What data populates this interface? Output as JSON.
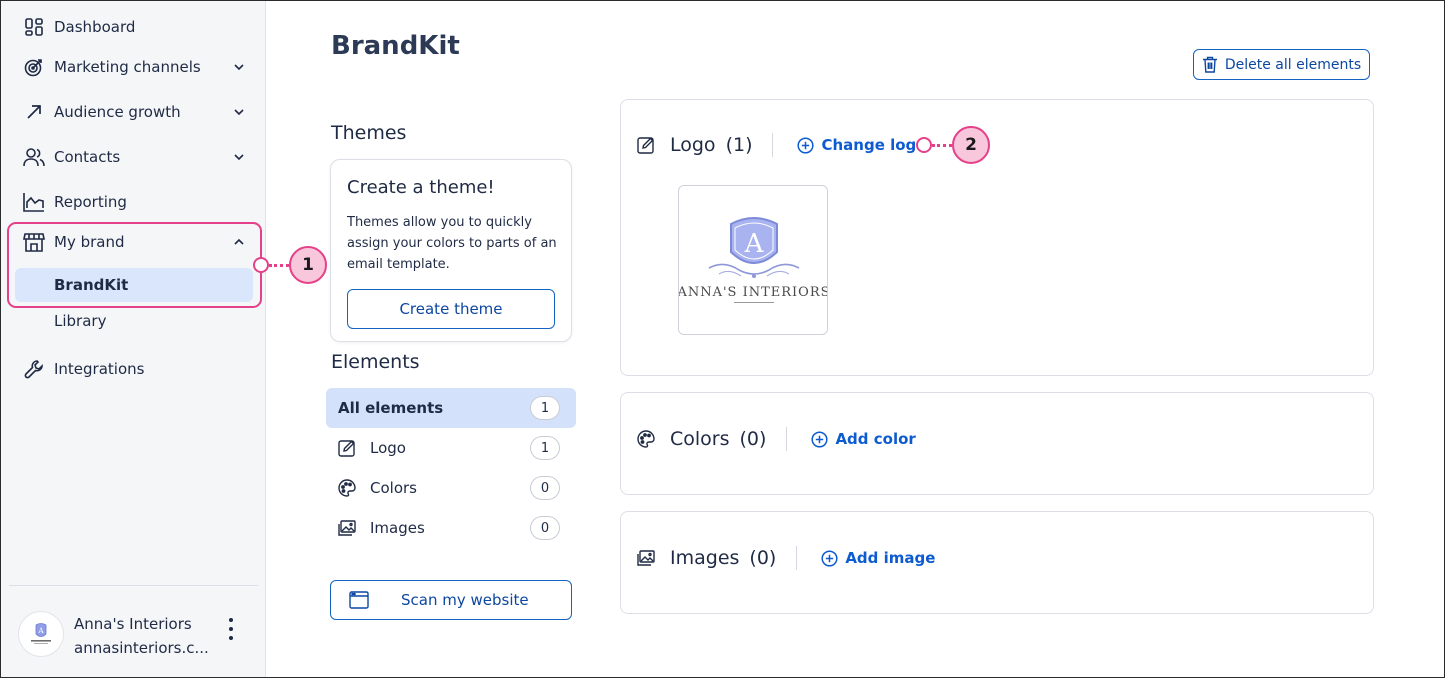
{
  "sidebar": {
    "items": [
      {
        "label": "Dashboard",
        "icon": "dashboard-icon"
      },
      {
        "label": "Marketing channels",
        "icon": "target-icon",
        "expandable": true
      },
      {
        "label": "Audience growth",
        "icon": "arrow-up-right-icon",
        "expandable": true
      },
      {
        "label": "Contacts",
        "icon": "contacts-icon",
        "expandable": true
      },
      {
        "label": "Reporting",
        "icon": "chart-icon"
      },
      {
        "label": "My brand",
        "icon": "storefront-icon",
        "expanded": true
      },
      {
        "label": "Integrations",
        "icon": "wrench-icon"
      }
    ],
    "sub_items": [
      {
        "label": "BrandKit",
        "active": true
      },
      {
        "label": "Library"
      }
    ],
    "account": {
      "name": "Anna's Interiors",
      "email": "annasinteriors.c..."
    }
  },
  "callouts": [
    "1",
    "2"
  ],
  "page": {
    "title": "BrandKit",
    "delete_all_label": "Delete all elements"
  },
  "themes": {
    "heading": "Themes",
    "card_title": "Create a theme!",
    "card_description": "Themes allow you to quickly assign your colors to parts of an email template.",
    "create_button": "Create theme"
  },
  "elements": {
    "heading": "Elements",
    "rows": [
      {
        "label": "All elements",
        "count": "1",
        "active": true
      },
      {
        "label": "Logo",
        "count": "1",
        "icon": "edit-icon"
      },
      {
        "label": "Colors",
        "count": "0",
        "icon": "palette-icon"
      },
      {
        "label": "Images",
        "count": "0",
        "icon": "image-icon"
      }
    ],
    "scan_button": "Scan my website"
  },
  "panels": {
    "logo": {
      "title": "Logo",
      "count": "(1)",
      "action": "Change logo",
      "logo_monogram": "A",
      "logo_text": "ANNA'S INTERIORS"
    },
    "colors": {
      "title": "Colors",
      "count": "(0)",
      "action": "Add color"
    },
    "images": {
      "title": "Images",
      "count": "(0)",
      "action": "Add image"
    }
  },
  "colors": {
    "accent": "#e5408a",
    "link": "#0d5bd1",
    "active_bg": "#d9e6fb"
  }
}
